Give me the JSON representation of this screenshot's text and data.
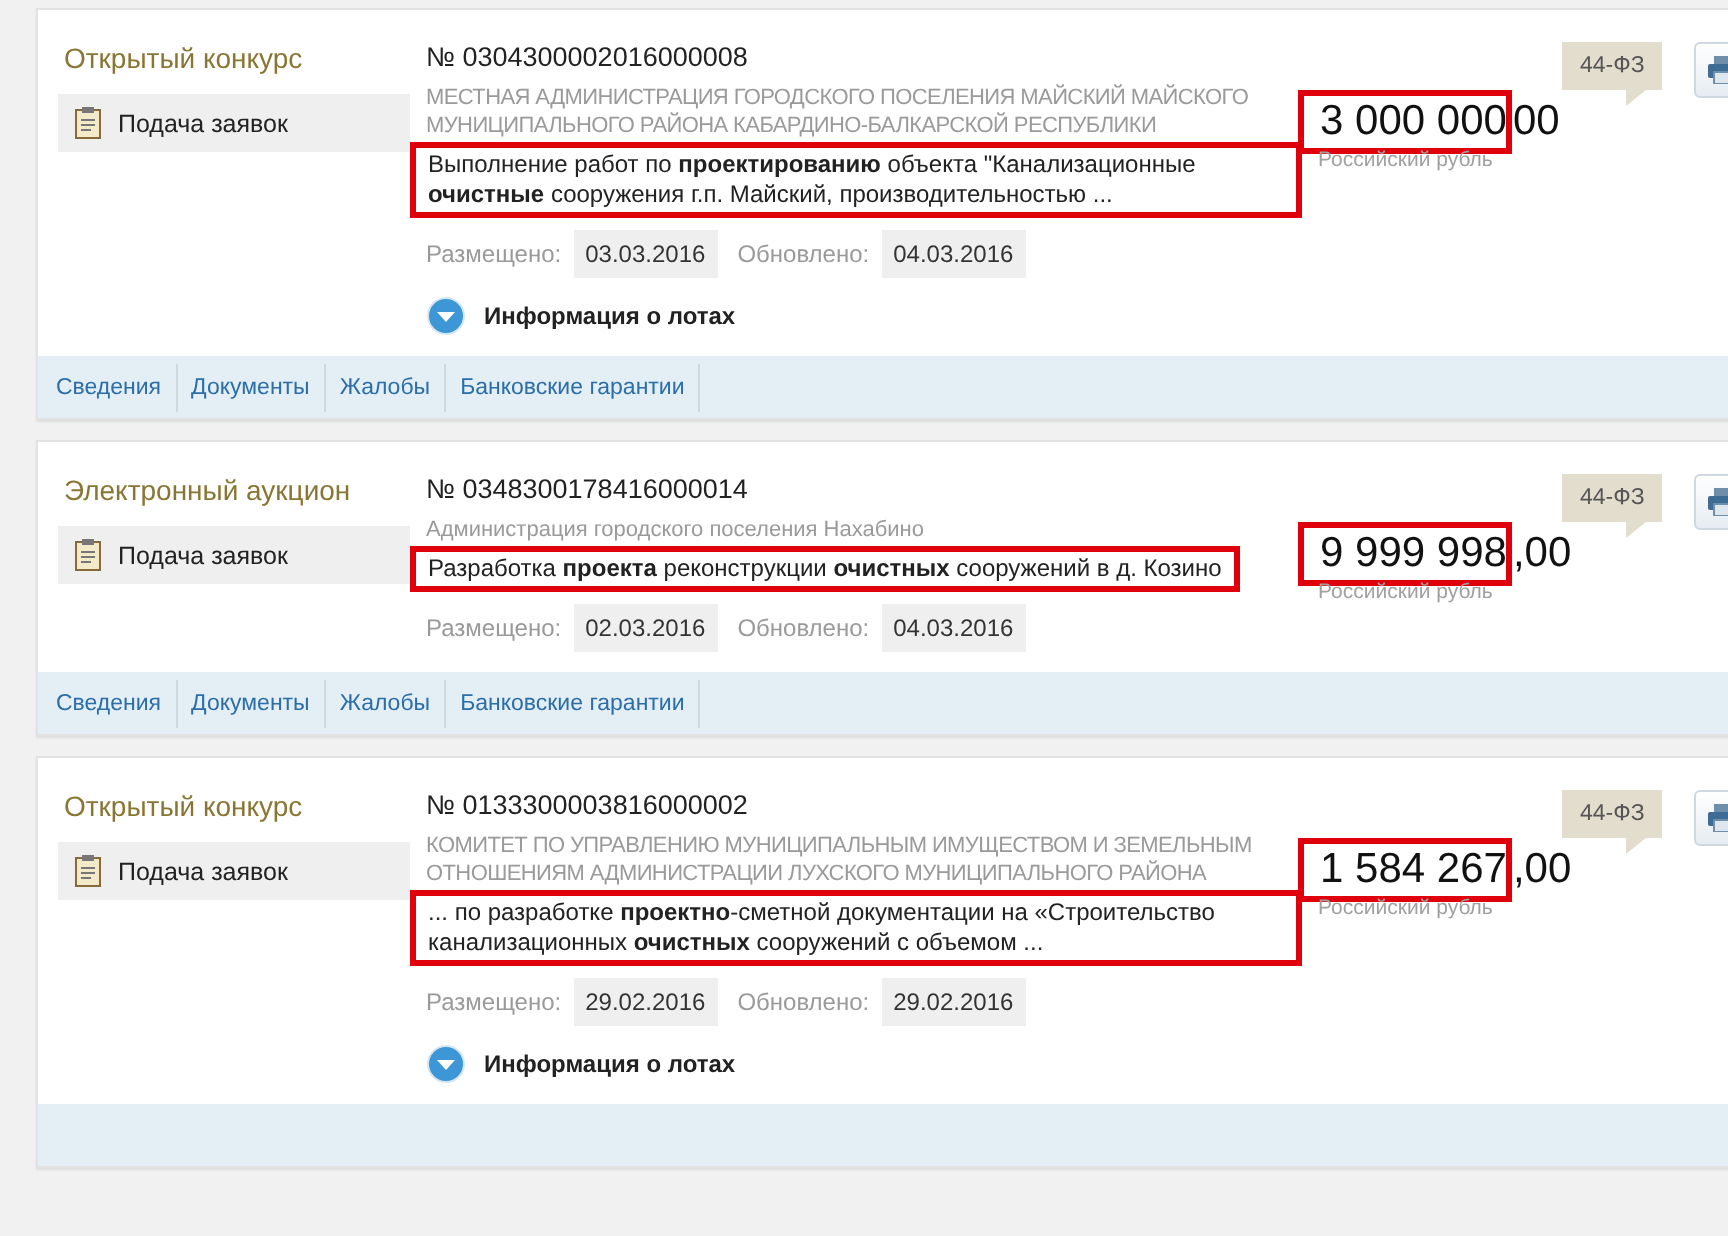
{
  "notices": [
    {
      "procedure": "Открытый конкурс",
      "stage": "Подача заявок",
      "number": "№ 0304300002016000008",
      "customer": "МЕСТНАЯ АДМИНИСТРАЦИЯ ГОРОДСКОГО ПОСЕЛЕНИЯ МАЙСКИЙ МАЙСКОГО МУНИЦИПАЛЬНОГО РАЙОНА КАБАРДИНО-БАЛКАРСКОЙ РЕСПУБЛИКИ",
      "customer_uppercase": true,
      "description": {
        "text": "Выполнение работ по **проектированию** объекта \"Канализационные **очистные** сооружения г.п. Майский, производительностью ...",
        "marked": true
      },
      "price": {
        "whole": "3 000 000",
        "fraction": "00",
        "marked": true
      },
      "currency": "Российский рубль",
      "law": "44-ФЗ",
      "posted_label": "Размещено:",
      "posted": "03.03.2016",
      "updated_label": "Обновлено:",
      "updated": "04.03.2016",
      "lots": "Информация о лотах",
      "links": [
        "Сведения",
        "Документы",
        "Жалобы",
        "Банковские гарантии"
      ]
    },
    {
      "procedure": "Электронный аукцион",
      "stage": "Подача заявок",
      "number": "№ 0348300178416000014",
      "customer": "Администрация городского поселения Нахабино",
      "customer_uppercase": false,
      "description": {
        "text": "Разработка **проекта** реконструкции **очистных** сооружений в д. Козино",
        "marked": true
      },
      "price": {
        "whole": "9 999 998",
        "fraction": ",00",
        "marked": true
      },
      "currency": "Российский рубль",
      "law": "44-ФЗ",
      "posted_label": "Размещено:",
      "posted": "02.03.2016",
      "updated_label": "Обновлено:",
      "updated": "04.03.2016",
      "links": [
        "Сведения",
        "Документы",
        "Жалобы",
        "Банковские гарантии"
      ]
    },
    {
      "procedure": "Открытый конкурс",
      "stage": "Подача заявок",
      "number": "№ 0133300003816000002",
      "customer": "КОМИТЕТ ПО УПРАВЛЕНИЮ МУНИЦИПАЛЬНЫМ ИМУЩЕСТВОМ И ЗЕМЕЛЬНЫМ ОТНОШЕНИЯМ АДМИНИСТРАЦИИ ЛУХСКОГО МУНИЦИПАЛЬНОГО РАЙОНА",
      "customer_uppercase": true,
      "description": {
        "text": "...   по разработке **проектно**-сметной документации на «Строительство канализационных **очистных** сооружений с объемом ...",
        "marked": true
      },
      "price": {
        "whole": "1 584 267",
        "fraction": ",00",
        "marked": true
      },
      "currency": "Российский рубль",
      "law": "44-ФЗ",
      "posted_label": "Размещено:",
      "posted": "29.02.2016",
      "updated_label": "Обновлено:",
      "updated": "29.02.2016",
      "lots": "Информация о лотах"
    }
  ]
}
